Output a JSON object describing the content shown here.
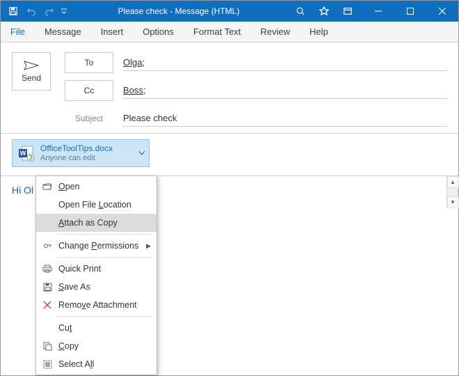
{
  "titlebar": {
    "title": "Please check  -  Message (HTML)"
  },
  "ribbon": {
    "file": "File",
    "message": "Message",
    "insert": "Insert",
    "options": "Options",
    "format_text": "Format Text",
    "review": "Review",
    "help": "Help"
  },
  "compose": {
    "send": "Send",
    "to_label": "To",
    "to_value": "Olga",
    "cc_label": "Cc",
    "cc_value": "Boss",
    "subject_label": "Subject",
    "subject_value": "Please check"
  },
  "attachment": {
    "name": "OfficeToolTips.docx",
    "subtitle": "Anyone can edit"
  },
  "body": {
    "text": "Hi Ol"
  },
  "menu": {
    "open_pre": "",
    "open_ul": "O",
    "open_post": "pen",
    "open_loc": "Open File ",
    "open_loc_ul": "L",
    "open_loc_post": "ocation",
    "attach_ul": "A",
    "attach_post": "ttach as Copy",
    "perm_pre": "Change ",
    "perm_ul": "P",
    "perm_post": "ermissions",
    "quick_print": "Quick Print",
    "save_ul": "S",
    "save_post": "ave As",
    "remove_pre": "Remo",
    "remove_ul": "v",
    "remove_post": "e Attachment",
    "cut_pre": "Cu",
    "cut_ul": "t",
    "copy_ul": "C",
    "copy_post": "opy",
    "select_pre": "Select A",
    "select_ul": "l",
    "select_post": "l"
  }
}
